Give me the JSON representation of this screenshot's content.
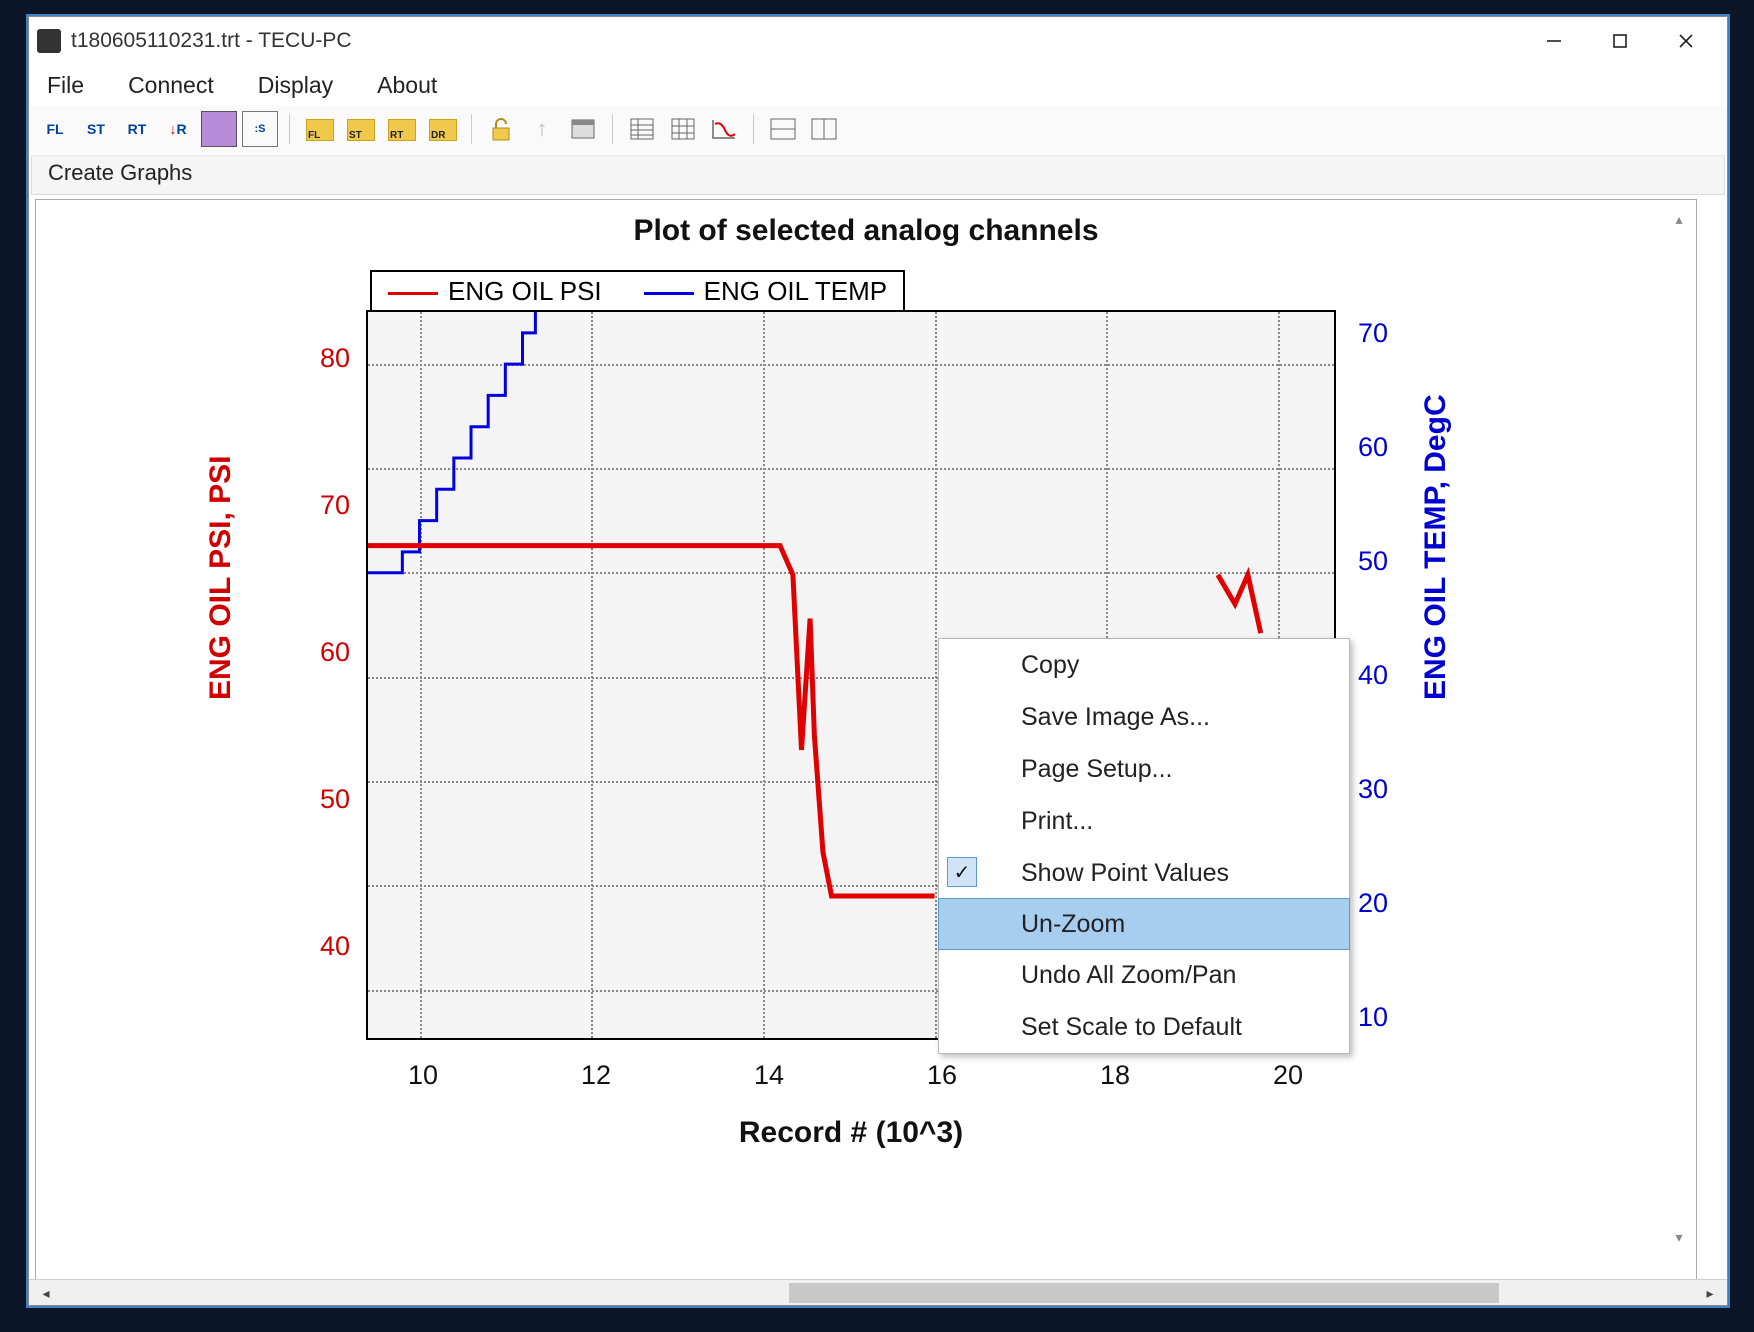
{
  "window": {
    "title": "t180605110231.trt - TECU-PC"
  },
  "menu": {
    "items": [
      "File",
      "Connect",
      "Display",
      "About"
    ]
  },
  "toolbar": {
    "fl": "FL",
    "st": "ST",
    "rt": "RT",
    "down_r": "R",
    "s_box": "S",
    "folder_fl": "FL",
    "folder_st": "ST",
    "folder_rt": "RT",
    "folder_dr": "DR"
  },
  "create_graphs_label": "Create Graphs",
  "chart_data": {
    "type": "line",
    "title": "Plot of selected analog channels",
    "xlabel": "Record # (10^3)",
    "x_ticks": [
      10,
      12,
      14,
      16,
      18,
      20
    ],
    "x_range": [
      9.4,
      20.7
    ],
    "y_left": {
      "label": "ENG OIL PSI, PSI",
      "ticks": [
        40,
        50,
        60,
        70,
        80
      ],
      "range": [
        35,
        85
      ],
      "color": "#d00000"
    },
    "y_right": {
      "label": "ENG OIL TEMP, DegC",
      "ticks": [
        10,
        20,
        30,
        40,
        50,
        60,
        70
      ],
      "range": [
        5,
        75
      ],
      "color": "#0000d0"
    },
    "legend": [
      {
        "name": "ENG OIL PSI",
        "color": "#e00000"
      },
      {
        "name": "ENG OIL TEMP",
        "color": "#0000e0"
      }
    ],
    "series": [
      {
        "name": "ENG OIL PSI",
        "axis": "left",
        "color": "#e00000",
        "points": [
          {
            "x": 9.4,
            "y": 69
          },
          {
            "x": 14.2,
            "y": 69
          },
          {
            "x": 14.35,
            "y": 67
          },
          {
            "x": 14.45,
            "y": 55
          },
          {
            "x": 14.55,
            "y": 64
          },
          {
            "x": 14.6,
            "y": 56
          },
          {
            "x": 14.7,
            "y": 48
          },
          {
            "x": 14.8,
            "y": 45
          },
          {
            "x": 16.0,
            "y": 45
          },
          {
            "x": 19.2,
            "y": null
          },
          {
            "x": 19.3,
            "y": 67
          },
          {
            "x": 19.5,
            "y": 65
          },
          {
            "x": 19.65,
            "y": 67
          },
          {
            "x": 19.8,
            "y": 63
          }
        ]
      },
      {
        "name": "ENG OIL TEMP",
        "axis": "right",
        "color": "#0000e0",
        "points": [
          {
            "x": 9.4,
            "y": 50
          },
          {
            "x": 9.6,
            "y": 50
          },
          {
            "x": 9.8,
            "y": 52
          },
          {
            "x": 10.0,
            "y": 55
          },
          {
            "x": 10.2,
            "y": 58
          },
          {
            "x": 10.4,
            "y": 61
          },
          {
            "x": 10.6,
            "y": 64
          },
          {
            "x": 10.8,
            "y": 67
          },
          {
            "x": 11.0,
            "y": 70
          },
          {
            "x": 11.2,
            "y": 73
          },
          {
            "x": 11.35,
            "y": 75
          }
        ]
      }
    ]
  },
  "context_menu": {
    "items": [
      {
        "label": "Copy",
        "checked": false,
        "highlight": false
      },
      {
        "label": "Save Image As...",
        "checked": false,
        "highlight": false
      },
      {
        "label": "Page Setup...",
        "checked": false,
        "highlight": false
      },
      {
        "label": "Print...",
        "checked": false,
        "highlight": false
      },
      {
        "label": "Show Point Values",
        "checked": true,
        "highlight": false
      },
      {
        "label": "Un-Zoom",
        "checked": false,
        "highlight": true
      },
      {
        "label": "Undo All Zoom/Pan",
        "checked": false,
        "highlight": false
      },
      {
        "label": "Set Scale to Default",
        "checked": false,
        "highlight": false
      }
    ]
  }
}
